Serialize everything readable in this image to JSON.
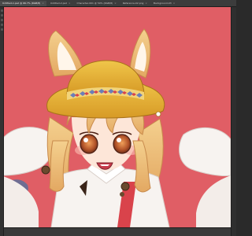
{
  "app": {
    "tabs": [
      {
        "label": "Untitled-1.psd @ 66.7% (RGB/8)"
      },
      {
        "label": "Untitled-2.psd"
      },
      {
        "label": "Character-001 @ 50% (RGB/8)"
      },
      {
        "label": "Reference-02.png"
      },
      {
        "label": "Background-03"
      }
    ]
  },
  "canvas": {
    "background_color": "#e05e65",
    "subject": "anime character illustration"
  },
  "colors": {
    "chrome_dark": "#2b2b2b",
    "tab_bar": "#3c3c3c",
    "canvas_bg": "#e05e65"
  }
}
